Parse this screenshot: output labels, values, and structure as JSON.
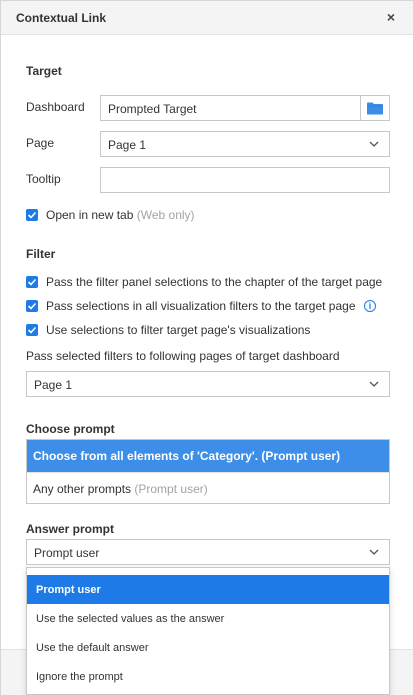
{
  "dialog": {
    "title": "Contextual Link",
    "close_label": "×"
  },
  "target": {
    "section_title": "Target",
    "dashboard_label": "Dashboard",
    "dashboard_value": "Prompted Target",
    "page_label": "Page",
    "page_value": "Page 1",
    "tooltip_label": "Tooltip",
    "tooltip_value": "",
    "open_new_tab_label": "Open in new tab",
    "open_new_tab_hint": "(Web only)",
    "open_new_tab_checked": true
  },
  "filter": {
    "section_title": "Filter",
    "options": [
      {
        "label": "Pass the filter panel selections to the chapter of the target page",
        "checked": true
      },
      {
        "label": "Pass selections in all visualization filters to the target page",
        "checked": true
      },
      {
        "label": "Use selections to filter target page's visualizations",
        "checked": true
      }
    ],
    "pass_pages_label": "Pass selected filters to following pages of target dashboard",
    "pass_pages_value": "Page 1"
  },
  "choose_prompt": {
    "section_title": "Choose prompt",
    "selected_item": "Choose from all elements of 'Category'. (Prompt user)",
    "other_item_label": "Any other prompts",
    "other_item_hint": "(Prompt user)"
  },
  "answer_prompt": {
    "section_title": "Answer prompt",
    "selected_value": "Prompt user",
    "options": [
      "Prompt user",
      "Use the selected values as the answer",
      "Use the default answer",
      "Ignore the prompt"
    ],
    "active_index": 0
  },
  "colors": {
    "accent": "#1e7ae6",
    "selected_row": "#3d8ee8",
    "folder_icon": "#3a8ee6"
  },
  "icons": {
    "close": "close-icon",
    "folder": "folder-icon",
    "chevron": "chevron-down-icon",
    "check": "check-icon",
    "info": "info-icon"
  }
}
